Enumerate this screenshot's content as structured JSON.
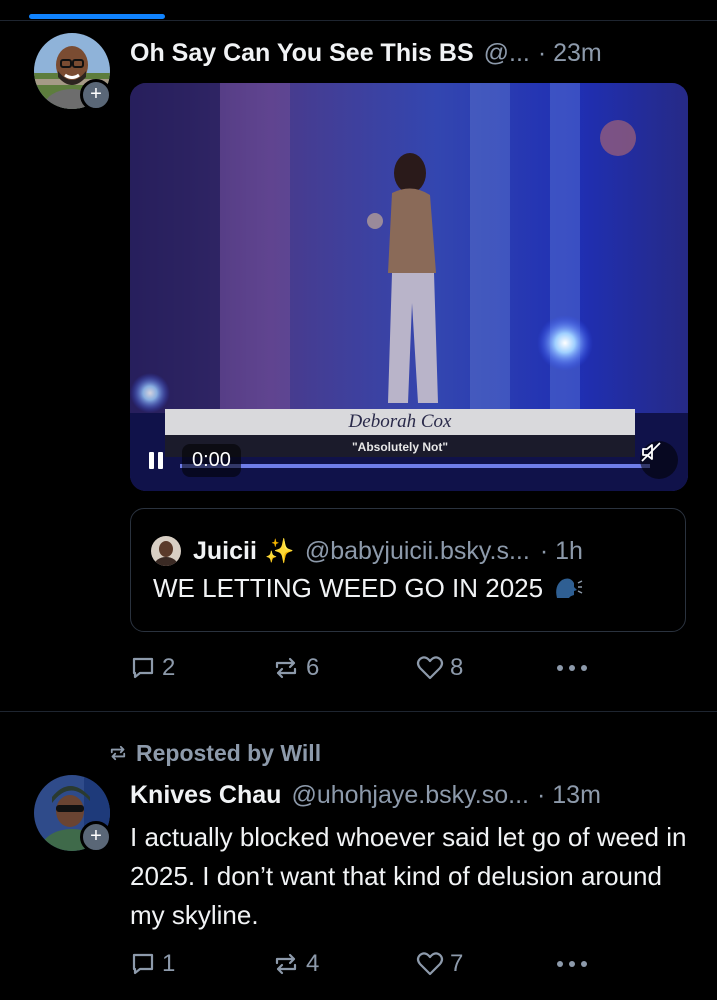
{
  "post1": {
    "author_name": "Oh Say Can You See This BS",
    "author_handle": "@...",
    "time": "· 23m",
    "video": {
      "caption_name": "Deborah Cox",
      "caption_subtitle": "\"Absolutely Not\"",
      "time": "0:00"
    },
    "quote": {
      "author_name": "Juicii",
      "sparkle": "✨",
      "author_handle": "@babyjuicii.bsky.s...",
      "time": "· 1h",
      "text": "WE LETTING WEED GO IN 2025"
    },
    "actions": {
      "replies": "2",
      "reposts": "6",
      "likes": "8"
    }
  },
  "post2": {
    "reposted_by": "Reposted by Will",
    "author_name": "Knives Chau",
    "author_handle": "@uhohjaye.bsky.so...",
    "time": "· 13m",
    "text": "I actually blocked whoever said let go of weed in 2025. I don’t want that kind of delusion around my skyline.",
    "actions": {
      "replies": "1",
      "reposts": "4",
      "likes": "7"
    }
  },
  "colors": {
    "background": "#000000",
    "tab_accent": "#1083fe",
    "muted_text": "#8d9aab",
    "primary_text": "#f1f3f5"
  }
}
